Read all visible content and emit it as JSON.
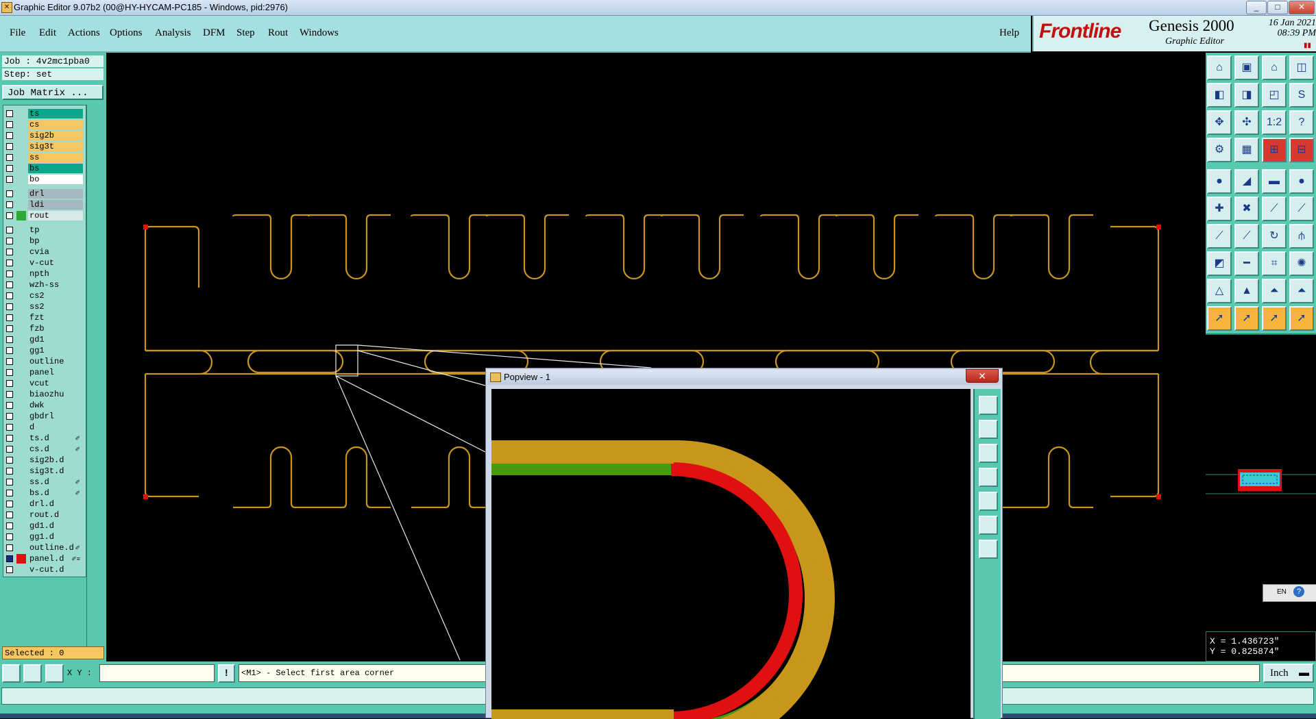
{
  "window": {
    "title": "Graphic Editor 9.07b2 (00@HY-HYCAM-PC185 - Windows, pid:2976)",
    "controls": [
      "_",
      "□",
      "✕"
    ]
  },
  "menu": [
    "File",
    "Edit",
    "Actions",
    "Options",
    "Analysis",
    "DFM",
    "Step",
    "Rout",
    "Windows"
  ],
  "help": "Help",
  "brand": {
    "logo": "Frontline",
    "product": "Genesis 2000",
    "subtitle": "Graphic Editor",
    "date": "16 Jan 2021",
    "time": "08:39 PM"
  },
  "job": {
    "job_line": "Job : 4v2mc1pba0",
    "step_line": "Step: set",
    "matrix_button": "Job Matrix ..."
  },
  "layers": [
    {
      "name": "ts",
      "color": "#0aa88a",
      "group": 1
    },
    {
      "name": "cs",
      "color": "#f6c760",
      "group": 1
    },
    {
      "name": "sig2b",
      "color": "#f6c760",
      "group": 1
    },
    {
      "name": "sig3t",
      "color": "#f6c760",
      "group": 1
    },
    {
      "name": "ss",
      "color": "#f6c760",
      "group": 1
    },
    {
      "name": "bs",
      "color": "#0aa88a",
      "group": 1
    },
    {
      "name": "bo",
      "color": "#ffffff",
      "group": 1
    },
    {
      "name": "drl",
      "color": "#a5b8c2",
      "group": 2
    },
    {
      "name": "ldi",
      "color": "#a5b8c2",
      "group": 2
    },
    {
      "name": "rout",
      "color": "#d8e8e8",
      "group": 2,
      "swatch": "#2fa836"
    },
    {
      "name": "tp",
      "color": "#9edbd0",
      "group": 3
    },
    {
      "name": "bp",
      "color": "#9edbd0",
      "group": 3
    },
    {
      "name": "cvia",
      "color": "#9edbd0",
      "group": 3
    },
    {
      "name": "v-cut",
      "color": "#9edbd0",
      "group": 3
    },
    {
      "name": "npth",
      "color": "#9edbd0",
      "group": 3
    },
    {
      "name": "wzh-ss",
      "color": "#9edbd0",
      "group": 3
    },
    {
      "name": "cs2",
      "color": "#9edbd0",
      "group": 3
    },
    {
      "name": "ss2",
      "color": "#9edbd0",
      "group": 3
    },
    {
      "name": "fzt",
      "color": "#9edbd0",
      "group": 3
    },
    {
      "name": "fzb",
      "color": "#9edbd0",
      "group": 3
    },
    {
      "name": "gd1",
      "color": "#9edbd0",
      "group": 3
    },
    {
      "name": "gg1",
      "color": "#9edbd0",
      "group": 3
    },
    {
      "name": "outline",
      "color": "#9edbd0",
      "group": 3
    },
    {
      "name": "panel",
      "color": "#9edbd0",
      "group": 3
    },
    {
      "name": "vcut",
      "color": "#9edbd0",
      "group": 3
    },
    {
      "name": "biaozhu",
      "color": "#9edbd0",
      "group": 3
    },
    {
      "name": "dwk",
      "color": "#9edbd0",
      "group": 3
    },
    {
      "name": "gbdrl",
      "color": "#9edbd0",
      "group": 3
    },
    {
      "name": "d",
      "color": "#9edbd0",
      "group": 3
    },
    {
      "name": "ts.d",
      "color": "#9edbd0",
      "group": 3,
      "flag": "✐"
    },
    {
      "name": "cs.d",
      "color": "#9edbd0",
      "group": 3,
      "flag": "✐"
    },
    {
      "name": "sig2b.d",
      "color": "#9edbd0",
      "group": 3
    },
    {
      "name": "sig3t.d",
      "color": "#9edbd0",
      "group": 3
    },
    {
      "name": "ss.d",
      "color": "#9edbd0",
      "group": 3,
      "flag": "✐"
    },
    {
      "name": "bs.d",
      "color": "#9edbd0",
      "group": 3,
      "flag": "✐"
    },
    {
      "name": "drl.d",
      "color": "#9edbd0",
      "group": 3
    },
    {
      "name": "rout.d",
      "color": "#9edbd0",
      "group": 3
    },
    {
      "name": "gd1.d",
      "color": "#9edbd0",
      "group": 3
    },
    {
      "name": "gg1.d",
      "color": "#9edbd0",
      "group": 3
    },
    {
      "name": "outline.d",
      "color": "#9edbd0",
      "group": 3,
      "flag": "✐"
    },
    {
      "name": "panel.d",
      "color": "#9edbd0",
      "group": 3,
      "swatch": "#e01010",
      "flag": "✐≡",
      "active": true
    },
    {
      "name": "v-cut.d",
      "color": "#9edbd0",
      "group": 3
    }
  ],
  "status": {
    "selected": "Selected : 0",
    "xy_label": "X Y :",
    "xy_value": "",
    "message": "<M1> - Select first area corner",
    "units": "Inch",
    "units_icon": "dropdown-icon"
  },
  "coords": {
    "x": "X = 1.436723\"",
    "y": "Y = 0.825874\""
  },
  "lang": "EN",
  "popview": {
    "title": "Popview - 1",
    "close": "✕"
  },
  "colors": {
    "menu_bg": "#a6dfe0",
    "panel_bg": "#58c9b0",
    "outline_stroke": "#c8961a",
    "highlight_red": "#e01010",
    "green_layer": "#4a9a10"
  },
  "toolbar_icons": [
    "home-icon",
    "zoom-icon",
    "window-icon",
    "split-icon",
    "pan-left-icon",
    "pan-right-icon",
    "zoom-area-icon",
    "route-icon",
    "fit-icon",
    "center-icon",
    "scale-icon",
    "help-icon",
    "measure-icon",
    "grid-icon",
    "snap-icon",
    "snap2-icon",
    "pad-icon",
    "line-icon",
    "ruler-icon",
    "dot-icon",
    "move-icon",
    "delete-icon",
    "connect-icon",
    "connect2-icon",
    "draw-line-icon",
    "cut-icon",
    "arc-icon",
    "align-icon",
    "pattern-icon",
    "minus-icon",
    "array-icon",
    "cluster-icon",
    "triangle-icon",
    "triangle2-icon",
    "triangle3-icon",
    "triangle4-icon",
    "pointer-icon",
    "pointer2-icon",
    "pointer3-icon",
    "pointer4-icon"
  ]
}
